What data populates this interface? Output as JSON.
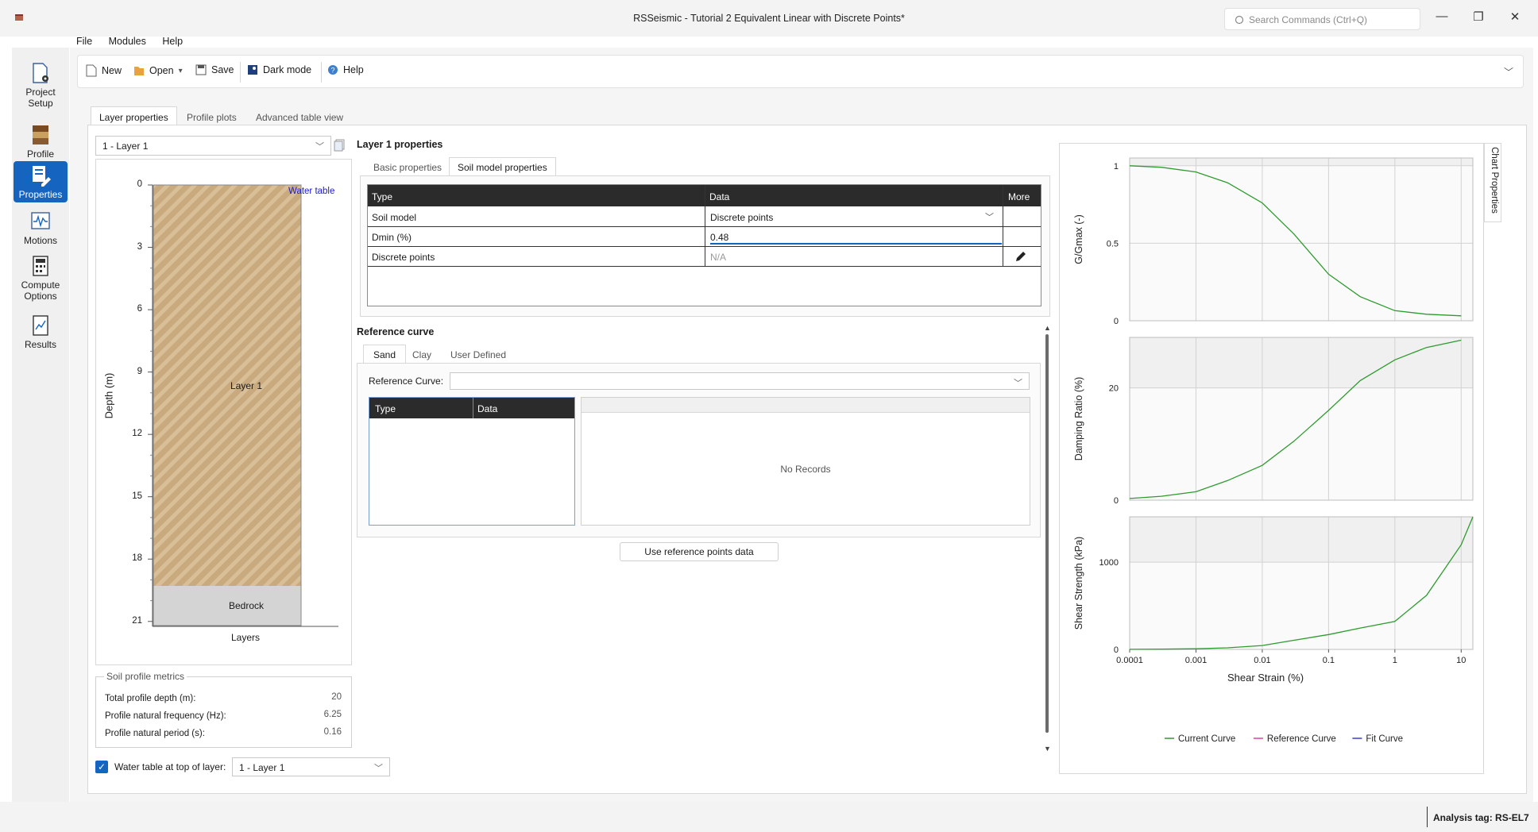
{
  "window": {
    "title": "RSSeismic - Tutorial 2 Equivalent Linear with Discrete Points*",
    "search_placeholder": "Search Commands (Ctrl+Q)",
    "controls": [
      "minimize",
      "restore",
      "close"
    ]
  },
  "menu": [
    "File",
    "Modules",
    "Help"
  ],
  "toolbar": {
    "new": "New",
    "open": "Open",
    "save": "Save",
    "dark_mode": "Dark mode",
    "help": "Help"
  },
  "rail": [
    {
      "label": "Project Setup",
      "icon": "project-setup-icon",
      "active": false
    },
    {
      "label": "Profile",
      "icon": "profile-icon",
      "active": false
    },
    {
      "label": "Properties",
      "icon": "properties-icon",
      "active": true
    },
    {
      "label": "Motions",
      "icon": "motions-icon",
      "active": false
    },
    {
      "label": "Compute Options",
      "icon": "compute-options-icon",
      "active": false
    },
    {
      "label": "Results",
      "icon": "results-icon",
      "active": false
    }
  ],
  "main_tabs": [
    "Layer properties",
    "Profile plots",
    "Advanced table view"
  ],
  "layer_select": "1 - Layer 1",
  "profile_plot": {
    "y_label": "Depth (m)",
    "y_ticks": [
      "0",
      "3",
      "6",
      "9",
      "12",
      "15",
      "18",
      "21"
    ],
    "x_label": "Layers",
    "water_table_label": "Water table",
    "layer_label": "Layer 1",
    "bedrock_label": "Bedrock"
  },
  "metrics": {
    "title": "Soil profile metrics",
    "rows": [
      {
        "label": "Total profile depth (m):",
        "value": "20"
      },
      {
        "label": "Profile natural frequency (Hz):",
        "value": "6.25"
      },
      {
        "label": "Profile natural period (s):",
        "value": "0.16"
      }
    ]
  },
  "water_table": {
    "checked": true,
    "label": "Water table at top of layer:",
    "value": "1 - Layer 1"
  },
  "layer_props": {
    "heading": "Layer 1 properties",
    "tabs": [
      "Basic properties",
      "Soil model properties"
    ],
    "headers": [
      "Type",
      "Data",
      "More"
    ],
    "rows": [
      {
        "type": "Soil model",
        "data": "Discrete points"
      },
      {
        "type": "Dmin (%)",
        "data": "0.48"
      },
      {
        "type": "Discrete points",
        "data": "N/A"
      }
    ]
  },
  "reference": {
    "heading": "Reference curve",
    "tabs": [
      "Sand",
      "Clay",
      "User Defined"
    ],
    "curve_label": "Reference Curve:",
    "table_headers": [
      "Type",
      "Data"
    ],
    "no_records": "No Records",
    "button": "Use reference points data"
  },
  "chart_side_tab": "Chart Properties",
  "status": {
    "analysis_tag": "Analysis tag: RS-EL7"
  },
  "chart_data": [
    {
      "type": "line",
      "ylabel": "G/Gmax (-)",
      "xscale": "log",
      "xlim": [
        0.0001,
        15
      ],
      "ylim": [
        0,
        1.05
      ],
      "y_ticks": [
        "0",
        "0.5",
        "1"
      ],
      "series": [
        {
          "color": "#2e9b2e",
          "x": [
            0.0001,
            0.0003,
            0.001,
            0.003,
            0.01,
            0.03,
            0.1,
            0.3,
            1,
            3,
            10
          ],
          "y": [
            1.0,
            0.99,
            0.96,
            0.89,
            0.76,
            0.56,
            0.3,
            0.155,
            0.065,
            0.042,
            0.032
          ]
        }
      ]
    },
    {
      "type": "line",
      "ylabel": "Damping Ratio (%)",
      "xscale": "log",
      "xlim": [
        0.0001,
        15
      ],
      "ylim": [
        0,
        29
      ],
      "y_ticks": [
        "0",
        "20"
      ],
      "series": [
        {
          "color": "#2e9b2e",
          "x": [
            0.0001,
            0.0003,
            0.001,
            0.003,
            0.01,
            0.03,
            0.1,
            0.3,
            1,
            3,
            10
          ],
          "y": [
            0.3,
            0.7,
            1.5,
            3.5,
            6.2,
            10.5,
            16.0,
            21.3,
            25.0,
            27.2,
            28.5
          ]
        }
      ]
    },
    {
      "type": "line",
      "ylabel": "Shear Strength (kPa)",
      "xlabel": "Shear Strain (%)",
      "xscale": "log",
      "xlim": [
        0.0001,
        15
      ],
      "ylim": [
        0,
        1520
      ],
      "x_ticks": [
        "0.0001",
        "0.001",
        "0.01",
        "0.1",
        "1",
        "10"
      ],
      "y_ticks": [
        "0",
        "1000"
      ],
      "series": [
        {
          "color": "#2e9b2e",
          "x": [
            0.0001,
            0.0003,
            0.001,
            0.003,
            0.01,
            0.03,
            0.1,
            0.3,
            1,
            3,
            10,
            15
          ],
          "y": [
            1,
            3,
            7,
            18,
            45,
            105,
            170,
            245,
            320,
            620,
            1200,
            1520
          ]
        }
      ]
    }
  ],
  "chart_legend": [
    {
      "name": "Current Curve",
      "color": "#2e9b2e"
    },
    {
      "name": "Reference Curve",
      "color": "#e23fa0"
    },
    {
      "name": "Fit Curve",
      "color": "#3a3ad6"
    }
  ]
}
